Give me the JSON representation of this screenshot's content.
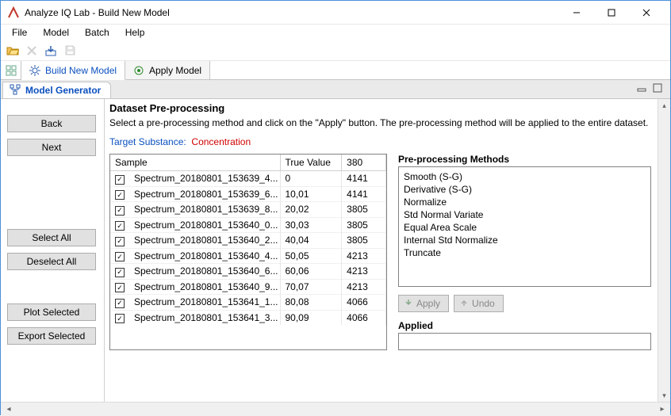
{
  "window": {
    "title": "Analyze IQ Lab - Build New Model"
  },
  "menu": {
    "file": "File",
    "model": "Model",
    "batch": "Batch",
    "help": "Help"
  },
  "perspectives": {
    "build": "Build New Model",
    "apply": "Apply Model"
  },
  "view": {
    "model_generator": "Model Generator"
  },
  "sidebar": {
    "back": "Back",
    "next": "Next",
    "select_all": "Select All",
    "deselect_all": "Deselect All",
    "plot_selected": "Plot Selected",
    "export_selected": "Export Selected"
  },
  "section": {
    "title": "Dataset Pre-processing",
    "desc": "Select a pre-processing method and click on the \"Apply\" button. The pre-processing method will be applied to the entire dataset.",
    "target_label": "Target Substance:",
    "target_value": "Concentration"
  },
  "table": {
    "headers": {
      "sample": "Sample",
      "true_value": "True Value",
      "col380": "380"
    },
    "rows": [
      {
        "checked": true,
        "sample": "Spectrum_20180801_153639_4...",
        "true_value": "0",
        "v380": "4141"
      },
      {
        "checked": true,
        "sample": "Spectrum_20180801_153639_6...",
        "true_value": "10,01",
        "v380": "4141"
      },
      {
        "checked": true,
        "sample": "Spectrum_20180801_153639_8...",
        "true_value": "20,02",
        "v380": "3805"
      },
      {
        "checked": true,
        "sample": "Spectrum_20180801_153640_0...",
        "true_value": "30,03",
        "v380": "3805"
      },
      {
        "checked": true,
        "sample": "Spectrum_20180801_153640_2...",
        "true_value": "40,04",
        "v380": "3805"
      },
      {
        "checked": true,
        "sample": "Spectrum_20180801_153640_4...",
        "true_value": "50,05",
        "v380": "4213"
      },
      {
        "checked": true,
        "sample": "Spectrum_20180801_153640_6...",
        "true_value": "60,06",
        "v380": "4213"
      },
      {
        "checked": true,
        "sample": "Spectrum_20180801_153640_9...",
        "true_value": "70,07",
        "v380": "4213"
      },
      {
        "checked": true,
        "sample": "Spectrum_20180801_153641_1...",
        "true_value": "80,08",
        "v380": "4066"
      },
      {
        "checked": true,
        "sample": "Spectrum_20180801_153641_3...",
        "true_value": "90,09",
        "v380": "4066"
      }
    ]
  },
  "methods": {
    "title": "Pre-processing Methods",
    "items": [
      "Smooth (S-G)",
      "Derivative (S-G)",
      "Normalize",
      "Std Normal Variate",
      "Equal Area Scale",
      "Internal Std Normalize",
      "Truncate"
    ],
    "apply_label": "Apply",
    "undo_label": "Undo",
    "applied_title": "Applied"
  }
}
